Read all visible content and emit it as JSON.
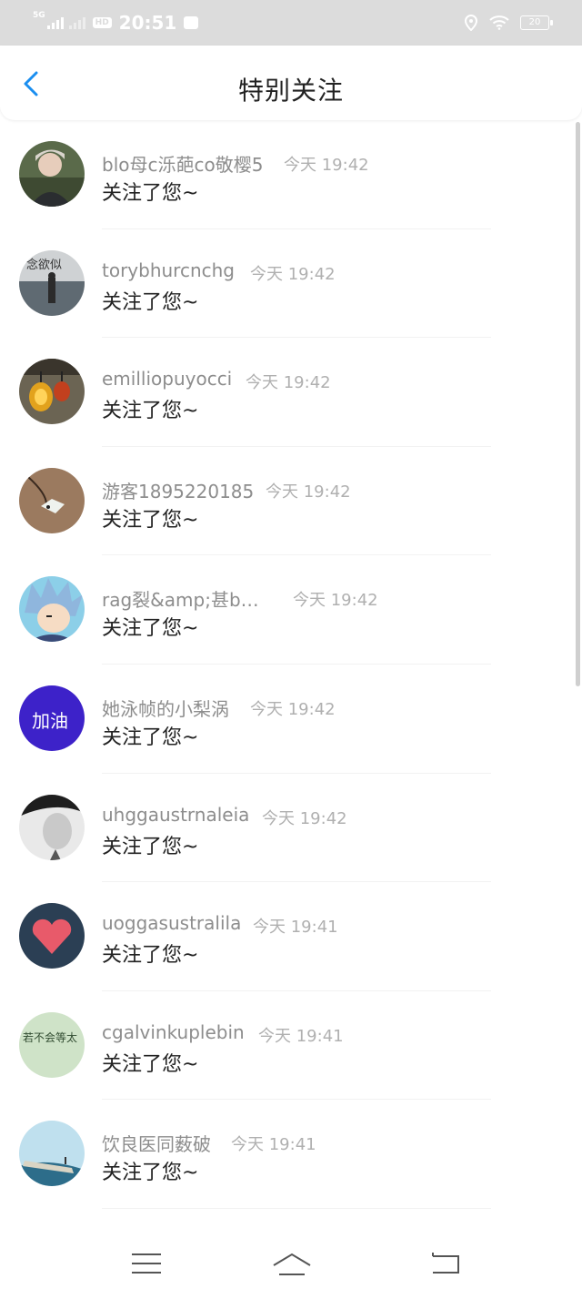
{
  "status_bar": {
    "network": "5G",
    "time": "20:51",
    "battery": "20"
  },
  "header": {
    "title": "特别关注"
  },
  "items": [
    {
      "name": "blo母c泺葩co敬樱5",
      "time": "今天 19:42",
      "message": "关注了您~"
    },
    {
      "name": "torybhurcnchg",
      "time": "今天 19:42",
      "message": "关注了您~"
    },
    {
      "name": "emilliopuyocci",
      "time": "今天 19:42",
      "message": "关注了您~"
    },
    {
      "name": "游客1895220185",
      "time": "今天 19:42",
      "message": "关注了您~"
    },
    {
      "name": "rag裂&amp;甚b…",
      "time": "今天 19:42",
      "message": "关注了您~"
    },
    {
      "name": "她泳帧的小梨涡",
      "time": "今天 19:42",
      "message": "关注了您~"
    },
    {
      "name": "uhggaustrnaleia",
      "time": "今天 19:42",
      "message": "关注了您~"
    },
    {
      "name": "uoggasustralila",
      "time": "今天 19:41",
      "message": "关注了您~"
    },
    {
      "name": "cgalvinkuplebin",
      "time": "今天 19:41",
      "message": "关注了您~"
    },
    {
      "name": "饮良医同薮破",
      "time": "今天 19:41",
      "message": "关注了您~"
    }
  ],
  "avatar_labels": {
    "a2": "念欲似",
    "a6": "加油",
    "a9": "若不会等太"
  },
  "colors": {
    "accent": "#1a8ef0",
    "name_text": "#8d8d8d",
    "time_text": "#b0b0b0"
  }
}
